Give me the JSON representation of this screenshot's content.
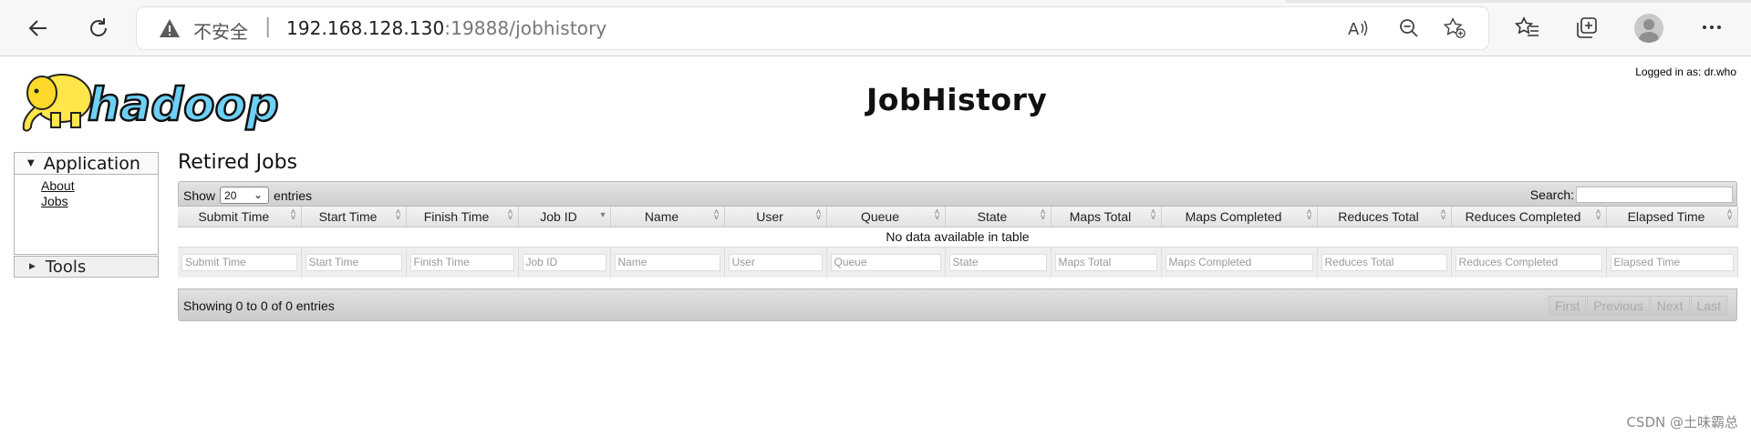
{
  "browser": {
    "security_label": "不安全",
    "url_host": "192.168.128.130",
    "url_rest": ":19888/jobhistory"
  },
  "page": {
    "logged_in": "Logged in as: dr.who",
    "title": "JobHistory",
    "logo_text": "hadoop"
  },
  "nav": {
    "application_label": "Application",
    "links": [
      "About",
      "Jobs"
    ],
    "tools_label": "Tools"
  },
  "main": {
    "section_title": "Retired Jobs",
    "show_label": "Show",
    "show_value": "20",
    "entries_label": "entries",
    "search_label": "Search:",
    "columns": [
      "Submit Time",
      "Start Time",
      "Finish Time",
      "Job ID",
      "Name",
      "User",
      "Queue",
      "State",
      "Maps Total",
      "Maps Completed",
      "Reduces Total",
      "Reduces Completed",
      "Elapsed Time"
    ],
    "empty_message": "No data available in table",
    "filters": [
      "Submit Time",
      "Start Time",
      "Finish Time",
      "Job ID",
      "Name",
      "User",
      "Queue",
      "State",
      "Maps Total",
      "Maps Completed",
      "Reduces Total",
      "Reduces Completed",
      "Elapsed Time"
    ],
    "info": "Showing 0 to 0 of 0 entries",
    "pager": [
      "First",
      "Previous",
      "Next",
      "Last"
    ]
  },
  "watermark": "CSDN @土味霸总"
}
